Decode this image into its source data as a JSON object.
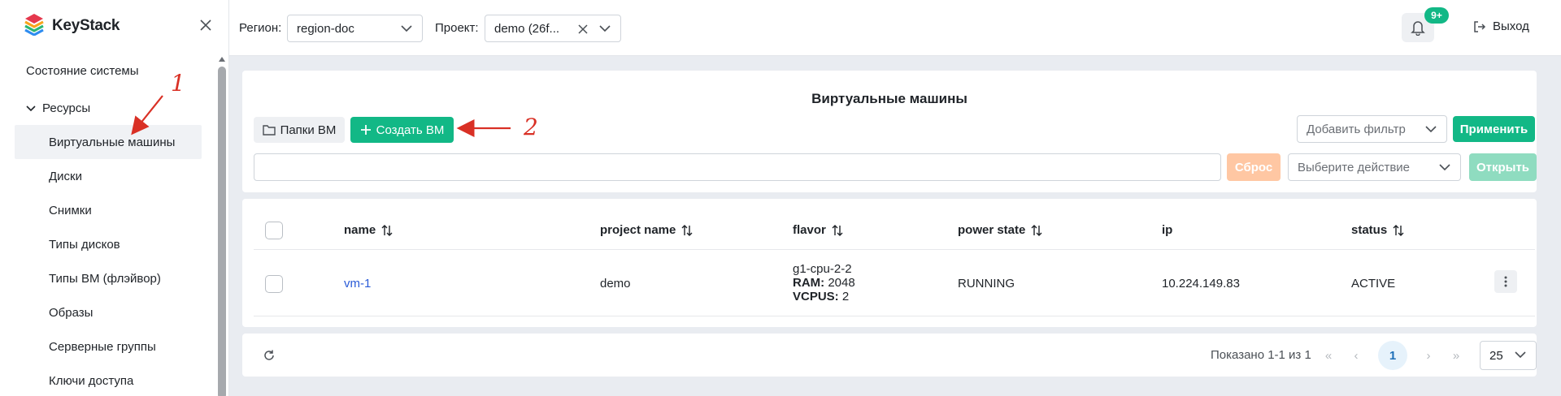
{
  "app": {
    "brand": "KeyStack"
  },
  "sidebar": {
    "system_state": "Состояние системы",
    "resources_group": "Ресурсы",
    "items": [
      {
        "label": "Виртуальные машины",
        "active": true
      },
      {
        "label": "Диски"
      },
      {
        "label": "Снимки"
      },
      {
        "label": "Типы дисков"
      },
      {
        "label": "Типы ВМ (флэйвор)"
      },
      {
        "label": "Образы"
      },
      {
        "label": "Серверные группы"
      },
      {
        "label": "Ключи доступа"
      }
    ]
  },
  "topbar": {
    "region_label": "Регион:",
    "region_value": "region-doc",
    "project_label": "Проект:",
    "project_value": "demo (26f...",
    "notifications_badge": "9+",
    "logout_label": "Выход"
  },
  "main": {
    "title": "Виртуальные машины",
    "folders_button": "Папки ВМ",
    "create_button": "Создать ВМ",
    "filter_placeholder": "Добавить фильтр",
    "apply_button": "Применить",
    "search_value": "",
    "reset_button": "Сброс",
    "action_placeholder": "Выберите действие",
    "open_button": "Открыть"
  },
  "table": {
    "columns": [
      "name",
      "project name",
      "flavor",
      "power state",
      "ip",
      "status"
    ],
    "rows": [
      {
        "name": "vm-1",
        "project_name": "demo",
        "flavor_name": "g1-cpu-2-2",
        "ram_label": "RAM:",
        "ram_value": "2048",
        "vcpus_label": "VCPUS:",
        "vcpus_value": "2",
        "power_state": "RUNNING",
        "ip": "10.224.149.83",
        "status": "ACTIVE"
      }
    ]
  },
  "pagination": {
    "info": "Показано 1-1 из 1",
    "current_page": "1",
    "page_size": "25"
  },
  "annotations": {
    "marker_1": "1",
    "marker_2": "2"
  },
  "colors": {
    "accent": "#12b886",
    "link": "#2a5bd7",
    "annotation": "#d93025",
    "reset_disabled": "#ffc7a3",
    "open_disabled": "#8fdcc0"
  }
}
